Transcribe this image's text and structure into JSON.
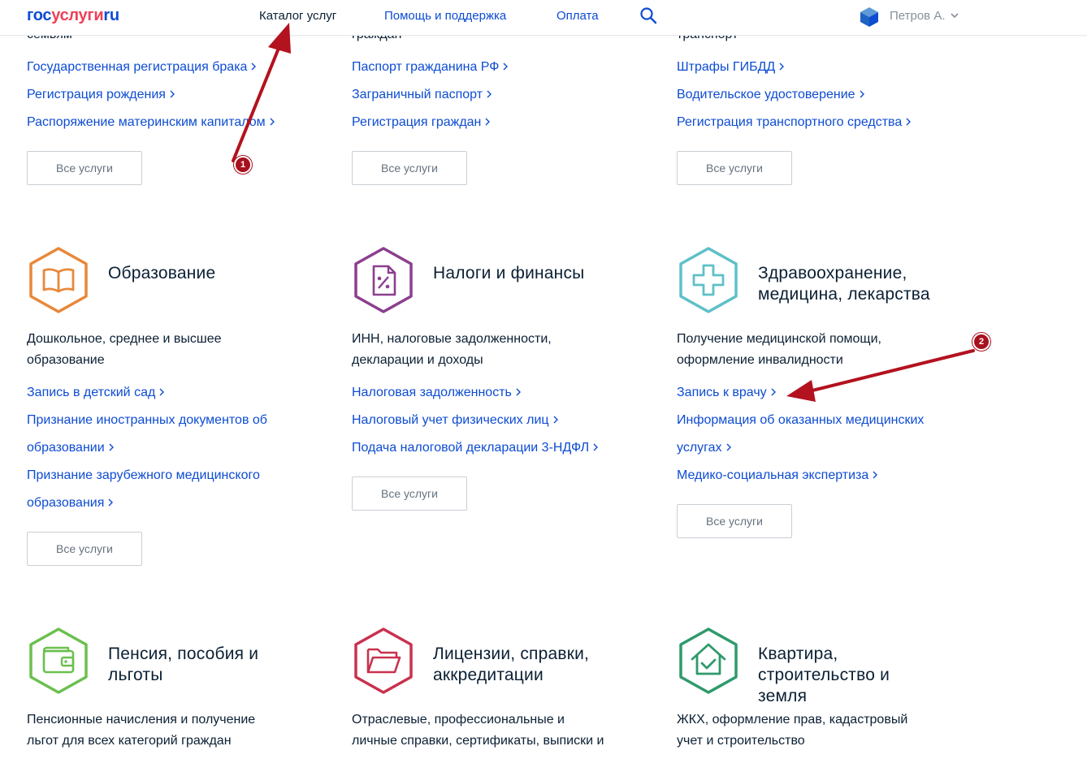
{
  "header": {
    "logo_part1": "гос",
    "logo_part2": "услуги",
    "logo_part3": "ru",
    "nav": [
      "Каталог услуг",
      "Помощь и поддержка",
      "Оплата"
    ],
    "user_name": "Петров А.",
    "search_icon": "search-icon",
    "user_icon": "user-cube-icon"
  },
  "top_section": {
    "cut_titles": [
      "семьям",
      "граждан",
      "транспорт"
    ],
    "col1_links": [
      "Государственная регистрация брака",
      "Регистрация рождения",
      "Распоряжение материнским капиталом"
    ],
    "col2_links": [
      "Паспорт гражданина РФ",
      "Заграничный паспорт",
      "Регистрация граждан"
    ],
    "col3_links": [
      "Штрафы ГИБДД",
      "Водительское удостоверение",
      "Регистрация транспортного средства"
    ]
  },
  "all_services_label": "Все услуги",
  "categories": [
    {
      "title_lines": [
        "Образование"
      ],
      "desc_lines": [
        "Дошкольное, среднее и высшее",
        "образование"
      ],
      "link_lines": [
        "Запись в детский сад",
        "Признание иностранных документов об",
        "образовании",
        "Признание зарубежного медицинского",
        "образования"
      ],
      "icon": "book-icon",
      "color": "#e8883a"
    },
    {
      "title_lines": [
        "Налоги и финансы"
      ],
      "desc_lines": [
        "ИНН, налоговые задолженности,",
        "декларации и доходы"
      ],
      "link_lines": [
        "Налоговая задолженность",
        "Налоговый учет физических лиц",
        "Подача налоговой декларации 3-НДФЛ"
      ],
      "icon": "tax-document-icon",
      "color": "#8b3f8e"
    },
    {
      "title_lines": [
        "Здравоохранение,",
        "медицина, лекарства"
      ],
      "desc_lines": [
        "Получение медицинской помощи,",
        "оформление инвалидности"
      ],
      "link_lines": [
        "Запись к врачу",
        "Информация об оказанных медицинских",
        "услугах",
        "Медико-социальная экспертиза"
      ],
      "icon": "medical-cross-icon",
      "color": "#5fc0c8"
    },
    {
      "title_lines": [
        "Пенсия, пособия и",
        "льготы"
      ],
      "desc_lines": [
        "Пенсионные начисления и получение",
        "льгот для всех категорий граждан"
      ],
      "icon": "wallet-icon",
      "color": "#6cbf4f"
    },
    {
      "title_lines": [
        "Лицензии, справки,",
        "аккредитации"
      ],
      "desc_lines": [
        "Отраслевые, профессиональные и",
        "личные справки, сертификаты, выписки и"
      ],
      "icon": "folder-icon",
      "color": "#c8324f"
    },
    {
      "title_lines": [
        "Квартира,",
        "строительство и",
        "земля"
      ],
      "desc_lines": [
        "ЖКХ, оформление прав, кадастровый",
        "учет и строительство"
      ],
      "icon": "house-check-icon",
      "color": "#2f9a6c"
    }
  ],
  "annotations": {
    "badge1": "1",
    "badge2": "2",
    "arrow_color": "#b3121f"
  }
}
